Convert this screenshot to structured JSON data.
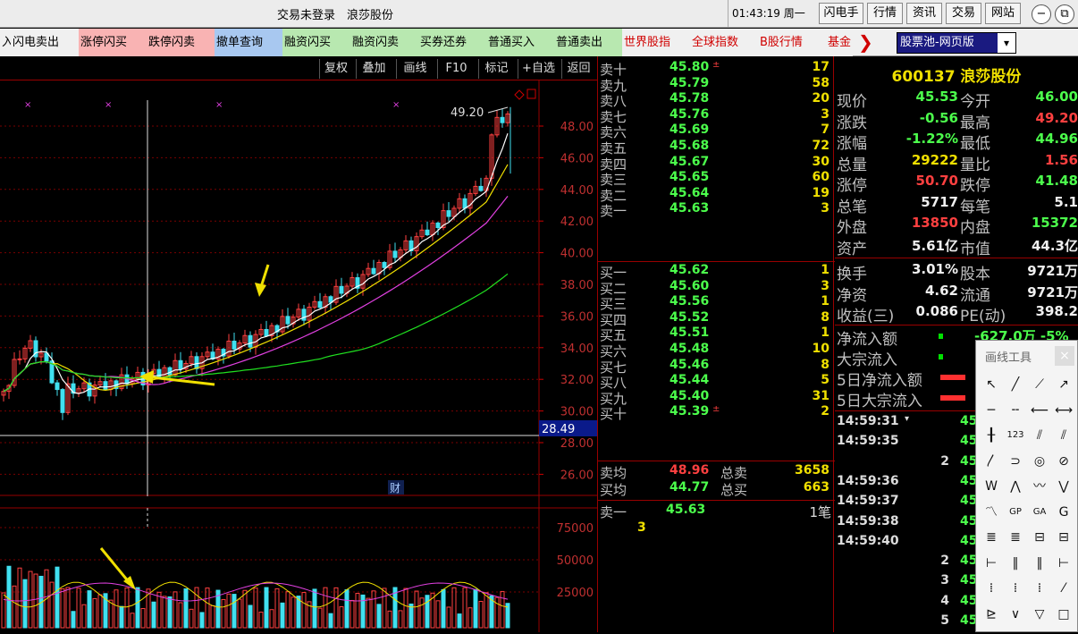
{
  "titlebar": {
    "title": "交易未登录　浪莎股份",
    "clock": "01:43:19 周一",
    "buttons": [
      "闪电手",
      "行情",
      "资讯",
      "交易",
      "网站"
    ],
    "minimize": "−",
    "restore": "⧉"
  },
  "quickbar": {
    "items": [
      {
        "label": "入",
        "color": "#000",
        "bg": "#f0f0f0"
      },
      {
        "label": "闪电卖出",
        "color": "#000",
        "bg": "#f0f0f0"
      },
      {
        "label": "涨停闪买",
        "color": "#000",
        "bg": "#f9b3b3"
      },
      {
        "label": "跌停闪卖",
        "color": "#000",
        "bg": "#f9b3b3"
      },
      {
        "label": "撤单查询",
        "color": "#000",
        "bg": "#a8c8f0"
      },
      {
        "label": "融资闪买",
        "color": "#000",
        "bg": "#b8e8b0"
      },
      {
        "label": "融资闪卖",
        "color": "#000",
        "bg": "#b8e8b0"
      },
      {
        "label": "买券还券",
        "color": "#000",
        "bg": "#b8e8b0"
      },
      {
        "label": "普通买入",
        "color": "#000",
        "bg": "#b8e8b0"
      },
      {
        "label": "普通卖出",
        "color": "#000",
        "bg": "#b8e8b0"
      },
      {
        "label": "世界股指",
        "color": "#d00000",
        "bg": "#f0f0f0"
      },
      {
        "label": "全球指数",
        "color": "#d00000",
        "bg": "#f0f0f0"
      },
      {
        "label": "B股行情",
        "color": "#d00000",
        "bg": "#f0f0f0"
      },
      {
        "label": "基金",
        "color": "#d00000",
        "bg": "#f0f0f0"
      }
    ],
    "arrow": "❯",
    "pool_select": "股票池-网页版",
    "pool_arrow": "▾"
  },
  "chart_toolbar": [
    "复权",
    "叠加",
    "画线",
    "F10",
    "标记",
    "+自选",
    "返回"
  ],
  "chart": {
    "price_labels": [
      "48.00",
      "46.00",
      "44.00",
      "42.00",
      "40.00",
      "38.00",
      "36.00",
      "34.00",
      "32.00",
      "30.00",
      "28.00",
      "26.00"
    ],
    "high_label": "49.20",
    "current_price_tag": "28.49",
    "cai_badge": "财",
    "vol_labels": [
      "75000",
      "50000",
      "25000"
    ]
  },
  "orderbook": {
    "asks": [
      {
        "label": "卖十",
        "price": "45.80",
        "vol": "17",
        "mark": "±"
      },
      {
        "label": "卖九",
        "price": "45.79",
        "vol": "58"
      },
      {
        "label": "卖八",
        "price": "45.78",
        "vol": "20"
      },
      {
        "label": "卖七",
        "price": "45.76",
        "vol": "3"
      },
      {
        "label": "卖六",
        "price": "45.69",
        "vol": "7"
      },
      {
        "label": "卖五",
        "price": "45.68",
        "vol": "72"
      },
      {
        "label": "卖四",
        "price": "45.67",
        "vol": "30"
      },
      {
        "label": "卖三",
        "price": "45.65",
        "vol": "60"
      },
      {
        "label": "卖二",
        "price": "45.64",
        "vol": "19"
      },
      {
        "label": "卖一",
        "price": "45.63",
        "vol": "3"
      }
    ],
    "bids": [
      {
        "label": "买一",
        "price": "45.62",
        "vol": "1"
      },
      {
        "label": "买二",
        "price": "45.60",
        "vol": "3"
      },
      {
        "label": "买三",
        "price": "45.56",
        "vol": "1"
      },
      {
        "label": "买四",
        "price": "45.52",
        "vol": "8"
      },
      {
        "label": "买五",
        "price": "45.51",
        "vol": "1"
      },
      {
        "label": "买六",
        "price": "45.48",
        "vol": "10"
      },
      {
        "label": "买七",
        "price": "45.46",
        "vol": "8"
      },
      {
        "label": "买八",
        "price": "45.44",
        "vol": "5"
      },
      {
        "label": "买九",
        "price": "45.40",
        "vol": "31"
      },
      {
        "label": "买十",
        "price": "45.39",
        "vol": "2",
        "mark": "±"
      }
    ],
    "avg_sell": {
      "label": "卖均",
      "price": "48.96",
      "tlabel": "总卖",
      "total": "3658"
    },
    "avg_buy": {
      "label": "买均",
      "price": "44.77",
      "tlabel": "总买",
      "total": "663"
    },
    "queue": {
      "label": "卖一",
      "price": "45.63",
      "unit": "1笔",
      "count": "3"
    }
  },
  "quote": {
    "title": "600137 浪莎股份",
    "rows": [
      {
        "l1": "现价",
        "v1": "45.53",
        "c1": "#4cff4c",
        "l2": "今开",
        "v2": "46.00",
        "c2": "#4cff4c"
      },
      {
        "l1": "涨跌",
        "v1": "-0.56",
        "c1": "#4cff4c",
        "l2": "最高",
        "v2": "49.20",
        "c2": "#ff4040"
      },
      {
        "l1": "涨幅",
        "v1": "-1.22%",
        "c1": "#4cff4c",
        "l2": "最低",
        "v2": "44.96",
        "c2": "#4cff4c"
      },
      {
        "l1": "总量",
        "v1": "29222",
        "c1": "#f0e000",
        "l2": "量比",
        "v2": "1.56",
        "c2": "#ff4040"
      },
      {
        "l1": "涨停",
        "v1": "50.70",
        "c1": "#ff4040",
        "l2": "跌停",
        "v2": "41.48",
        "c2": "#4cff4c"
      },
      {
        "l1": "总笔",
        "v1": "5717",
        "c1": "#f0f0f0",
        "l2": "每笔",
        "v2": "5.1",
        "c2": "#f0f0f0"
      },
      {
        "l1": "外盘",
        "v1": "13850",
        "c1": "#ff4040",
        "l2": "内盘",
        "v2": "15372",
        "c2": "#4cff4c"
      },
      {
        "l1": "资产",
        "v1": "5.61亿",
        "c1": "#f0f0f0",
        "l2": "市值",
        "v2": "44.3亿",
        "c2": "#f0f0f0"
      },
      {
        "l1": "换手",
        "v1": "3.01%",
        "c1": "#f0f0f0",
        "l2": "股本",
        "v2": "9721万",
        "c2": "#f0f0f0"
      },
      {
        "l1": "净资",
        "v1": "4.62",
        "c1": "#f0f0f0",
        "l2": "流通",
        "v2": "9721万",
        "c2": "#f0f0f0"
      },
      {
        "l1": "收益(三)",
        "v1": "0.086",
        "c1": "#f0f0f0",
        "l2": "PE(动)",
        "v2": "398.2",
        "c2": "#f0f0f0"
      }
    ],
    "flows": [
      "净流入额",
      "大宗流入",
      "5日净流入额",
      "5日大宗流入"
    ],
    "flow_partial": "-627.0万 -5%",
    "ticks": [
      "14:59:31",
      "14:59:35",
      "2",
      "14:59:36",
      "14:59:37",
      "14:59:38",
      "14:59:40",
      "2",
      "3",
      "4",
      "5"
    ],
    "tick_prices": [
      "45",
      "45",
      "45",
      "45",
      "45",
      "45",
      "45",
      "45",
      "45",
      "45",
      "45"
    ]
  },
  "drawtool": {
    "title": "画线工具",
    "close": "×",
    "icons": [
      "↖",
      "╱",
      "⟋",
      "↗",
      "─",
      "╌",
      "⟵",
      "⟷",
      "╂",
      "123",
      "⫽",
      "⫽",
      "〳",
      "⊃",
      "◎",
      "⊘",
      "W",
      "⋀",
      "〰",
      "⋁",
      "〽",
      "GP",
      "GA",
      "G",
      "≣",
      "≣",
      "⊟",
      "⊟",
      "⊢",
      "‖",
      "‖",
      "⊢",
      "⁞",
      "⁞",
      "⁞",
      "⁄",
      "⊵",
      "∨",
      "▽",
      "□"
    ]
  }
}
